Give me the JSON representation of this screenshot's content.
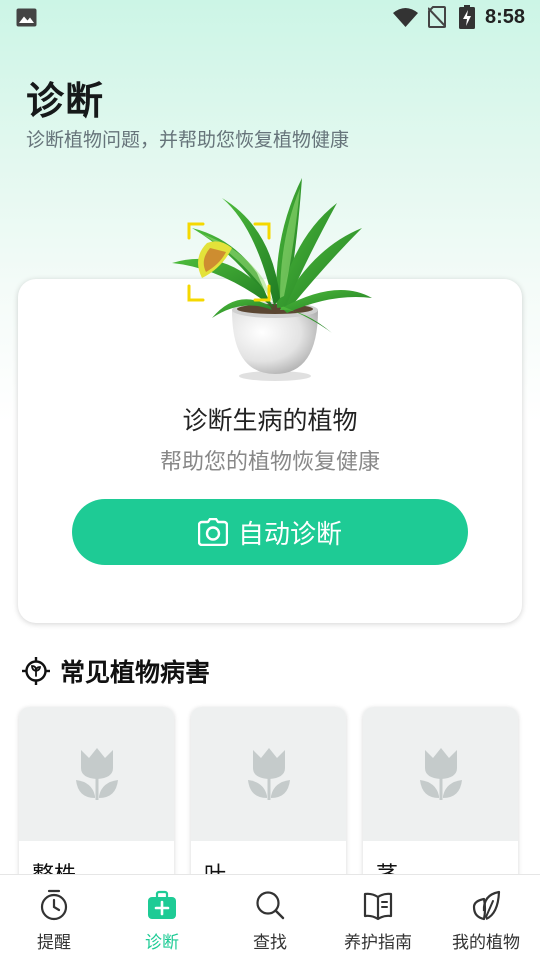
{
  "status_bar": {
    "time": "8:58",
    "icons": [
      "gallery-icon",
      "wifi-icon",
      "no-sim-icon",
      "battery-charging-icon"
    ]
  },
  "header": {
    "title": "诊断",
    "subtitle": "诊断植物问题，并帮助您恢复植物健康"
  },
  "diagnose_card": {
    "title": "诊断生病的植物",
    "subtitle": "帮助您的植物恢复健康",
    "button_label": "自动诊断",
    "button_icon": "camera-icon"
  },
  "common_diseases": {
    "title": "常见植物病害",
    "icon": "target-plant-icon",
    "items": [
      {
        "label": "整株",
        "icon": "tulip-placeholder-icon"
      },
      {
        "label": "叶",
        "icon": "tulip-placeholder-icon"
      },
      {
        "label": "茎",
        "icon": "tulip-placeholder-icon"
      }
    ]
  },
  "tab_bar": {
    "active_index": 1,
    "tabs": [
      {
        "label": "提醒",
        "icon": "alarm-clock-icon"
      },
      {
        "label": "诊断",
        "icon": "first-aid-kit-icon"
      },
      {
        "label": "查找",
        "icon": "search-icon"
      },
      {
        "label": "养护指南",
        "icon": "book-icon"
      },
      {
        "label": "我的植物",
        "icon": "leaf-icon"
      }
    ]
  },
  "colors": {
    "accent": "#1ecb95",
    "background_top": "#ccf5e6",
    "scan_frame": "#f5d800"
  }
}
